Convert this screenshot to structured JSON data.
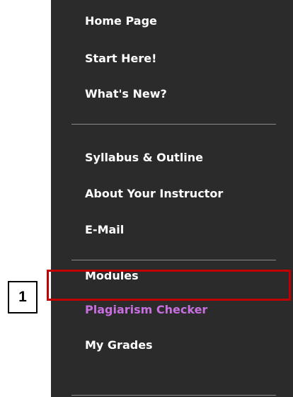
{
  "nav": {
    "items": [
      {
        "label": "Home Page"
      },
      {
        "label": "Start Here!"
      },
      {
        "label": "What's New?"
      },
      {
        "label": "Syllabus & Outline"
      },
      {
        "label": "About Your Instructor"
      },
      {
        "label": "E-Mail"
      },
      {
        "label": "Modules"
      },
      {
        "label": "Plagiarism Checker"
      },
      {
        "label": "My Grades"
      }
    ]
  },
  "annotation": {
    "callout_number": "1",
    "highlight_color": "#c00000"
  },
  "colors": {
    "panel_background": "#2b2b2b",
    "item_text": "#ffffff",
    "visited_link": "#c86fe0",
    "divider": "#8a8a8a"
  }
}
